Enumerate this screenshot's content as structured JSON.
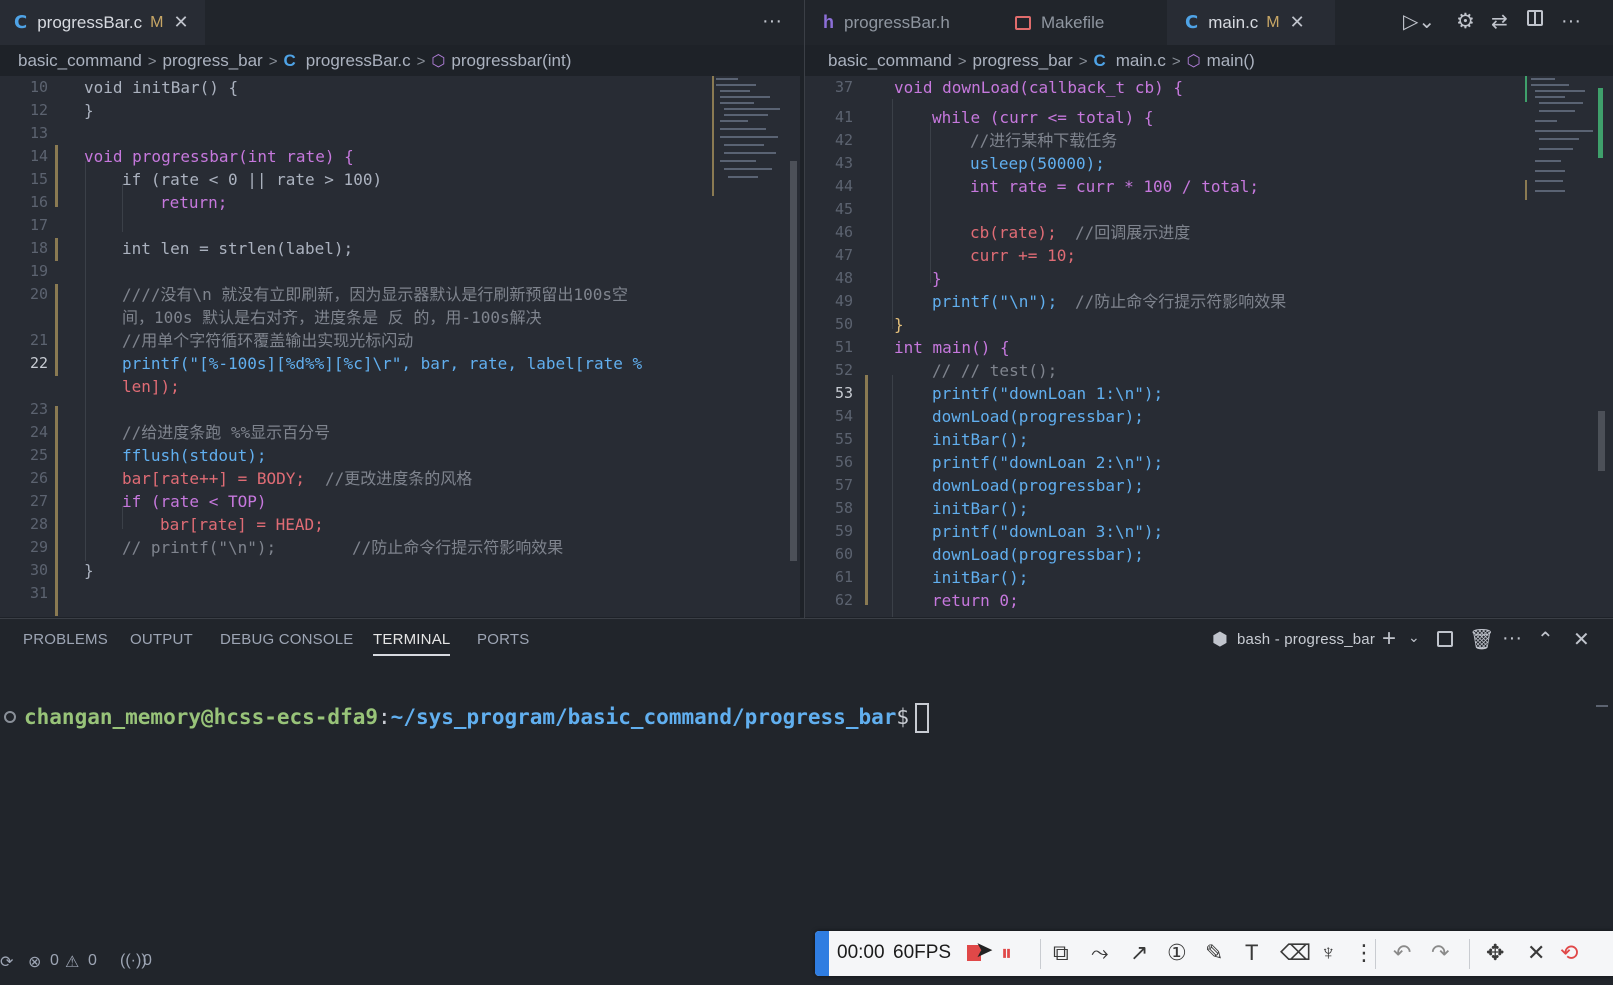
{
  "left_tabs": [
    {
      "label": "progressBar.c",
      "modified": "M",
      "active": true
    }
  ],
  "right_tabs": [
    {
      "label": "progressBar.h",
      "active": false
    },
    {
      "label": "Makefile",
      "active": false
    },
    {
      "label": "main.c",
      "modified": "M",
      "active": true
    }
  ],
  "left_crumbs": {
    "p1": "basic_command",
    "p2": "progress_bar",
    "file": "progressBar.c",
    "func": "progressbar(int)"
  },
  "right_crumbs": {
    "p1": "basic_command",
    "p2": "progress_bar",
    "file": "main.c",
    "func": "main()"
  },
  "left_lines": [
    "10",
    "12",
    "13",
    "14",
    "15",
    "16",
    "17",
    "18",
    "19",
    "20",
    "",
    "21",
    "22",
    "",
    "23",
    "24",
    "25",
    "26",
    "27",
    "28",
    "29",
    "30",
    "31"
  ],
  "right_lines": [
    "37",
    "41",
    "42",
    "43",
    "44",
    "45",
    "46",
    "47",
    "48",
    "49",
    "50",
    "51",
    "52",
    "53",
    "54",
    "55",
    "56",
    "57",
    "58",
    "59",
    "60",
    "61",
    "62"
  ],
  "left_code": {
    "l10": "void initBar() {",
    "l12": "}",
    "l14": "void progressbar(int rate) {",
    "l15": "if (rate < 0 || rate > 100)",
    "l16": "return;",
    "l18": "int len = strlen(label);",
    "l20a": "////没有\\n 就没有立即刷新，因为显示器默认是行刷新预留出100s空",
    "l20b": "间，100s 默认是右对齐，进度条是  反 的，用-100s解决",
    "l21": "//用单个字符循环覆盖输出实现光标闪动",
    "l22a": "printf(\"[%-100s][%d%%][%c]\\r\", bar, rate, label[rate %",
    "l22b": "len]);",
    "l24": "//给进度条跑  %%显示百分号",
    "l25": "fflush(stdout);",
    "l26a": "bar[rate++] = BODY;",
    "l26b": "//更改进度条的风格",
    "l27": "if (rate < TOP)",
    "l28": "bar[rate] = HEAD;",
    "l29a": "// printf(\"\\n\");",
    "l29b": "//防止命令行提示符影响效果",
    "l30": "}"
  },
  "right_code": {
    "l37": "void downLoad(callback_t cb) {",
    "l41": "while (curr <= total) {",
    "l42": "//进行某种下载任务",
    "l43": "usleep(50000);",
    "l44": "int rate = curr * 100 / total;",
    "l46a": "cb(rate);",
    "l46b": "//回调展示进度",
    "l47": "curr += 10;",
    "l48": "}",
    "l49a": "printf(\"\\n\");",
    "l49b": "//防止命令行提示符影响效果",
    "l50": "}",
    "l51": "int main() {",
    "l52": "// // test();",
    "l53": "printf(\"downLoan 1:\\n\");",
    "l54": "downLoad(progressbar);",
    "l55": "initBar();",
    "l56": "printf(\"downLoan 2:\\n\");",
    "l57": "downLoad(progressbar);",
    "l58": "initBar();",
    "l59": "printf(\"downLoan 3:\\n\");",
    "l60": "downLoad(progressbar);",
    "l61": "initBar();",
    "l62": "return 0;"
  },
  "panel": {
    "tabs": [
      "PROBLEMS",
      "OUTPUT",
      "DEBUG CONSOLE",
      "TERMINAL",
      "PORTS"
    ],
    "terminal_name": "bash - progress_bar"
  },
  "terminal": {
    "user_host": "changan_memory@hcss-ecs-dfa9",
    "colon": ":",
    "path": "~/sys_program/basic_command/progress_bar",
    "prompt": "$"
  },
  "recorder": {
    "time": "00:00",
    "fps": "60FPS"
  },
  "status": {
    "errors": "0",
    "warnings": "0",
    "ports": "0"
  },
  "colors": {
    "accent": "#2f7de1",
    "user": "#98c379",
    "path": "#61afef",
    "record": "#e04848"
  }
}
